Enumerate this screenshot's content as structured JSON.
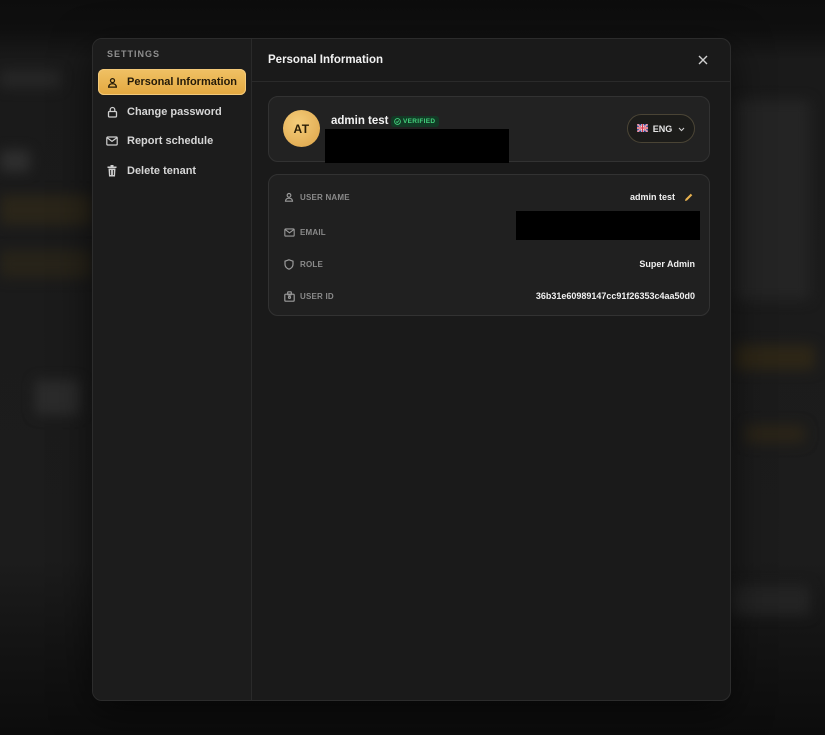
{
  "sidebar": {
    "heading": "SETTINGS",
    "items": [
      {
        "label": "Personal Information",
        "icon": "user-icon",
        "active": true
      },
      {
        "label": "Change password",
        "icon": "lock-icon",
        "active": false
      },
      {
        "label": "Report schedule",
        "icon": "mail-icon",
        "active": false
      },
      {
        "label": "Delete tenant",
        "icon": "trash-icon",
        "active": false
      }
    ]
  },
  "header": {
    "title": "Personal Information",
    "close_icon": "close-icon"
  },
  "profile": {
    "initials": "AT",
    "name": "admin test",
    "badge": "VERIFIED",
    "language": "ENG",
    "language_flag": "uk-flag-icon"
  },
  "details": {
    "user_name": {
      "label": "USER NAME",
      "value": "admin test",
      "icon": "user-icon"
    },
    "email": {
      "label": "EMAIL",
      "value": "",
      "icon": "mail-icon"
    },
    "role": {
      "label": "ROLE",
      "value": "Super Admin",
      "icon": "shield-icon"
    },
    "user_id": {
      "label": "USER ID",
      "value": "36b31e60989147cc91f26353c4aa50d0",
      "icon": "id-badge-icon"
    }
  },
  "colors": {
    "accent": "#e9b24f",
    "verified": "#43d27d",
    "background": "#1a1a1a"
  }
}
